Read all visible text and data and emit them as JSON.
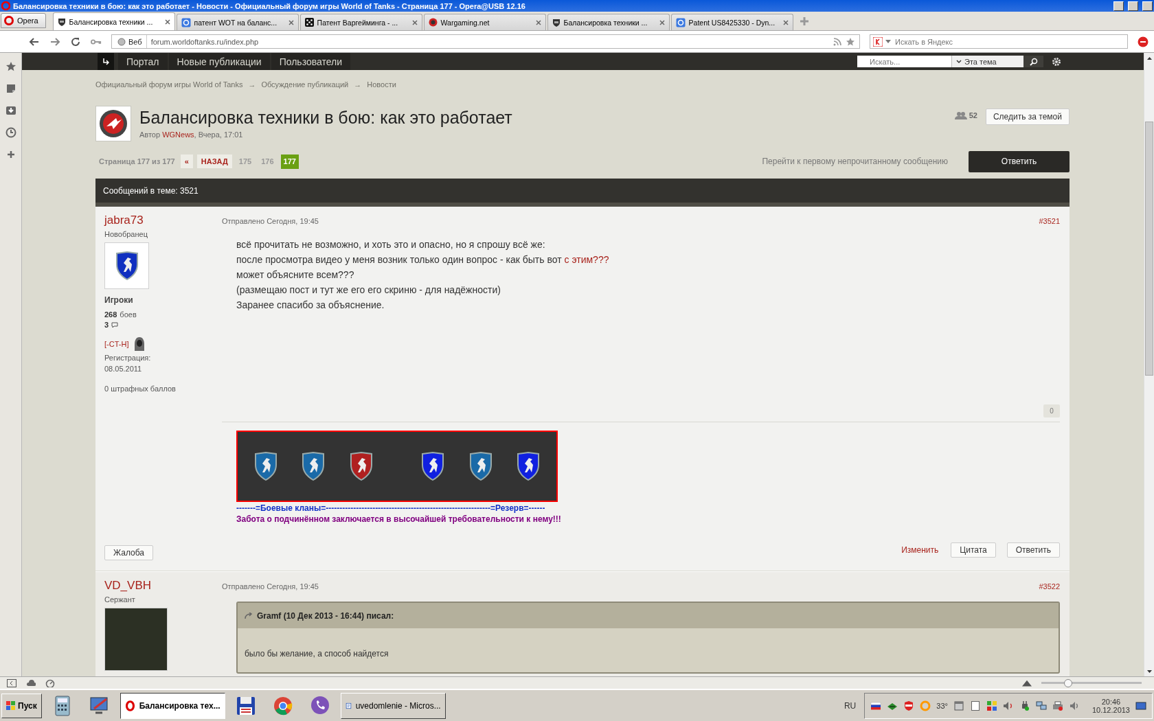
{
  "window": {
    "title": "Балансировка техники в бою: как это работает - Новости - Официальный форум игры World of Tanks - Страница 177 - Opera@USB 12.16"
  },
  "browser": {
    "menu_label": "Opera",
    "tabs": [
      {
        "label": "Балансировка техники ...",
        "selected": true,
        "kind": "wot"
      },
      {
        "label": "патент WOT на баланс...",
        "selected": false,
        "kind": "google"
      },
      {
        "label": "Патент Варгейминга - ...",
        "selected": false,
        "kind": "dice"
      },
      {
        "label": "Wargaming.net",
        "selected": false,
        "kind": "wg"
      },
      {
        "label": "Балансировка техники ...",
        "selected": false,
        "kind": "wot"
      },
      {
        "label": "Patent US8425330 - Dyn...",
        "selected": false,
        "kind": "google"
      }
    ],
    "address": {
      "badge": "Веб",
      "url": "forum.worldoftanks.ru/index.php"
    },
    "search": {
      "placeholder": "Искать в Яндекс"
    }
  },
  "forum_nav": {
    "items": [
      "Портал",
      "Новые публикации",
      "Пользователи"
    ],
    "search": {
      "placeholder": "Искать..."
    },
    "scope": "Эта тема"
  },
  "breadcrumbs": [
    "Официальный форум игры World of Tanks",
    "Обсуждение публикаций",
    "Новости"
  ],
  "breadcrumb_separator": "→",
  "topic": {
    "title": "Балансировка техники в бою: как это работает",
    "byline_prefix": "Автор",
    "author": "WGNews",
    "byline_suffix": ", Вчера, 17:01",
    "followers": "52",
    "follow_button": "Следить за темой"
  },
  "pagination": {
    "label": "Страница 177 из 177",
    "first": "«",
    "prev": "НАЗАД",
    "pages": [
      {
        "label": "175",
        "selected": false
      },
      {
        "label": "176",
        "selected": false
      },
      {
        "label": "177",
        "selected": true
      }
    ],
    "unread_link": "Перейти к первому непрочитанному сообщению",
    "reply_button": "Ответить"
  },
  "post_count": "Сообщений в теме: 3521",
  "posts": [
    {
      "kind": "member",
      "author": "jabra73",
      "rank": "Новобранец",
      "group": "Игроки",
      "battles": "268",
      "battles_label": "боев",
      "posts": "3",
      "clan": "[-CT-H]",
      "reg_label": "Регистрация:",
      "reg_date": "08.05.2011",
      "penalty": "0 штрафных баллов",
      "date": "Отправлено Сегодня, 19:45",
      "number": "#3521",
      "lines": [
        {
          "text": "всё прочитать не возможно, и хоть это и опасно, но я спрошу всё же:"
        },
        {
          "text": "после просмотра видео у меня возник только один вопрос - как быть вот ",
          "link": "с этим???"
        },
        {
          "text": "может объясните всем???"
        },
        {
          "text": "(размещаю пост и тут же его его скриню - для надёжности)"
        },
        {
          "text": "Заранее спасибо за объяснение."
        }
      ],
      "reputation": "0",
      "signature": [
        "-------=Боевые кланы=------------------------------------------------------------=Резерв=------",
        "Забота о подчинённом заключается в высочайшей требовательности к нему!!!"
      ],
      "report_button": "Жалоба",
      "actions": [
        {
          "label": "Изменить",
          "kind": "link"
        },
        {
          "label": "Цитата",
          "kind": "button"
        },
        {
          "label": "Ответить",
          "kind": "button"
        }
      ]
    },
    {
      "kind": "quoting",
      "author": "VD_VBH",
      "rank": "Сержант",
      "date": "Отправлено Сегодня, 19:45",
      "number": "#3522",
      "quote": {
        "header": "Gramf (10 Дек 2013 - 16:44) писал:",
        "text": "было бы желание, а способ найдется"
      }
    }
  ],
  "status_bar": {
    "zoom_slider": {
      "level": 0.27
    }
  },
  "taskbar": {
    "start": "Пуск",
    "windows": [
      {
        "label": "Балансировка тех...",
        "selected": true,
        "kind": "opera"
      },
      {
        "label": "uvedomlenie - Micros...",
        "selected": false,
        "kind": "word"
      }
    ],
    "language": "RU",
    "temperature": "33°",
    "time": "20:46",
    "date": "10.12.2013"
  }
}
